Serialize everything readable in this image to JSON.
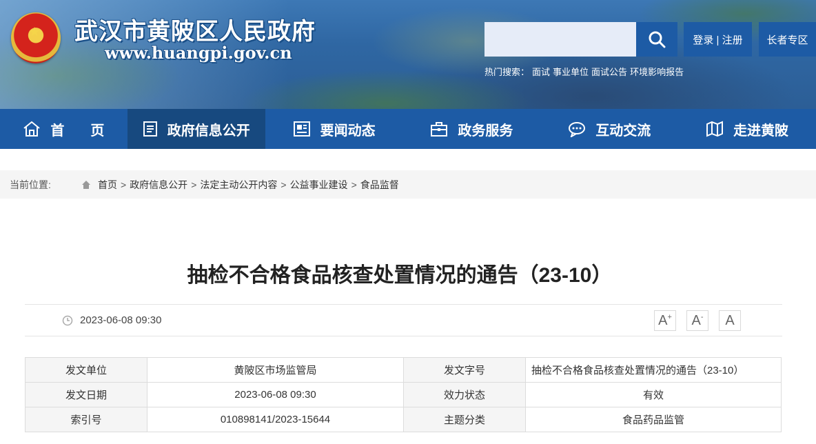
{
  "header": {
    "site_title": "武汉市黄陂区人民政府",
    "site_url": "www.huangpi.gov.cn",
    "search_placeholder": "",
    "login_label": "登录 | 注册",
    "elder_label": "长者专区",
    "hot_label": "热门搜索：",
    "hot_items": [
      "面试",
      "事业单位",
      "面试公告",
      "环境影响报告"
    ]
  },
  "nav": {
    "items": [
      {
        "label": "首页",
        "icon": "home-icon"
      },
      {
        "label": "政府信息公开",
        "icon": "document-list-icon"
      },
      {
        "label": "要闻动态",
        "icon": "newspaper-icon"
      },
      {
        "label": "政务服务",
        "icon": "briefcase-icon"
      },
      {
        "label": "互动交流",
        "icon": "chat-bubble-icon"
      },
      {
        "label": "走进黄陂",
        "icon": "map-icon"
      }
    ],
    "active": "政府信息公开"
  },
  "breadcrumb": {
    "label": "当前位置:",
    "items": [
      "首页",
      "政府信息公开",
      "法定主动公开内容",
      "公益事业建设",
      "食品监督"
    ],
    "separator": ">"
  },
  "article": {
    "title": "抽检不合格食品核查处置情况的通告（23-10）",
    "date": "2023-06-08 09:30",
    "font_buttons": [
      "A+",
      "A-",
      "A"
    ]
  },
  "info_table": {
    "rows": [
      {
        "label1": "发文单位",
        "value1": "黄陂区市场监管局",
        "label2": "发文字号",
        "value2": "抽检不合格食品核查处置情况的通告（23-10）"
      },
      {
        "label1": "发文日期",
        "value1": "2023-06-08 09:30",
        "label2": "效力状态",
        "value2": "有效"
      },
      {
        "label1": "索引号",
        "value1": "010898141/2023-15644",
        "label2": "主题分类",
        "value2": "食品药品监管"
      }
    ]
  },
  "colors": {
    "nav_bg": "#1d5ba5",
    "nav_active": "#17497f",
    "crumb_bg": "#f5f5f5"
  }
}
